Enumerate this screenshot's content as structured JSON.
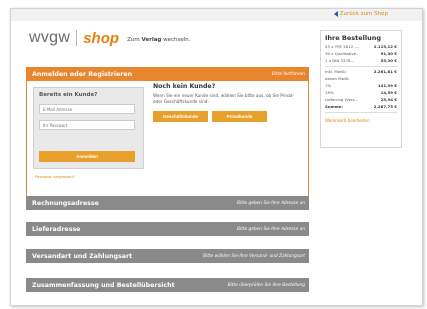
{
  "topbar": {
    "back_label": "Zurück zum Shop"
  },
  "header": {
    "logo_wvgw": "wvgw",
    "logo_shop": "shop",
    "tagline_prefix": "Zum",
    "tagline_bold": "Verlag",
    "tagline_suffix": "wechseln."
  },
  "login": {
    "title": "Anmelden oder Registrieren",
    "hint": "Bitte fortfahren",
    "existing_title": "Bereits ein Kunde?",
    "email_placeholder": "E-Mail Adresse",
    "password_placeholder": "Ihr Passwort",
    "login_button": "Anmelden",
    "forgot_link": "Passwort vergessen?",
    "new_title": "Noch kein Kunde?",
    "new_desc": "Wenn Sie ein neuer Kunde sind, wählen Sie bitte aus, ob Sie Privat- oder Geschäftskunde sind:",
    "business_button": "Geschäftskunde",
    "private_button": "Privatkunde"
  },
  "sections": [
    {
      "title": "Rechnungsadresse",
      "hint": "Bitte geben Sie Ihre Adresse an"
    },
    {
      "title": "Lieferadresse",
      "hint": "Bitte geben Sie Ihre Adresse an"
    },
    {
      "title": "Versandart und Zahlungsart",
      "hint": "Bitte wählen Sie Ihre Versand- und Zahlungsart"
    },
    {
      "title": "Zusammenfassung und Bestellübersicht",
      "hint": "Bitte überprüfen Sie Ihre Bestellung"
    }
  ],
  "order": {
    "title": "Ihre Bestellung",
    "items": [
      {
        "label": "25 x TRF 2012 -...",
        "value": "2.115,12 €"
      },
      {
        "label": "30 x Qualitative...",
        "value": "91,30 €"
      },
      {
        "label": "1 x DIN 3378...",
        "value": "55,30 €"
      }
    ],
    "subtotal_label": "Inkl. MwSt.:",
    "subtotal_value": "2.261,81 €",
    "tax_head": "davon MwSt.",
    "tax": [
      {
        "label": "7%",
        "value": "141,99 €"
      },
      {
        "label": "19%",
        "value": "14,59 €"
      }
    ],
    "shipping_label": "Lieferung (Vers...",
    "shipping_value": "25,94 €",
    "total_label": "Summe:",
    "total_value": "2.287,75 €",
    "edit_link": "Warenkorb bearbeiten"
  }
}
